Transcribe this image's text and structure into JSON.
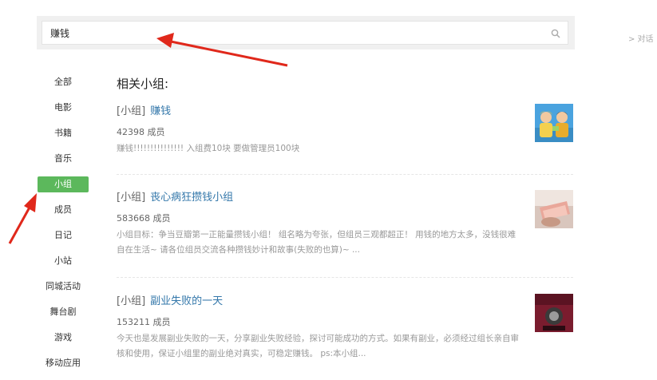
{
  "search": {
    "query": "赚钱"
  },
  "side_link": "> 对话",
  "nav": {
    "items": [
      {
        "label": "全部",
        "active": false
      },
      {
        "label": "电影",
        "active": false
      },
      {
        "label": "书籍",
        "active": false
      },
      {
        "label": "音乐",
        "active": false
      },
      {
        "label": "小组",
        "active": true
      },
      {
        "label": "成员",
        "active": false
      },
      {
        "label": "日记",
        "active": false
      },
      {
        "label": "小站",
        "active": false
      },
      {
        "label": "同城活动",
        "active": false
      },
      {
        "label": "舞台剧",
        "active": false
      },
      {
        "label": "游戏",
        "active": false
      },
      {
        "label": "移动应用",
        "active": false
      }
    ]
  },
  "section_title": "相关小组:",
  "results": [
    {
      "tag": "[小组]",
      "name": "赚钱",
      "members": "42398 成员",
      "description": "赚钱!!!!!!!!!!!!!!! 入组费10块 要做管理员100块"
    },
    {
      "tag": "[小组]",
      "name": "丧心病狂攒钱小组",
      "members": "583668 成员",
      "description": "小组目标：争当豆瓣第一正能量攒钱小组！ 组名略为夸张，但组员三观都超正！ 用钱的地方太多，没钱很难自在生活~ 请各位组员交流各种攒钱妙计和故事(失败的也算)~ ..."
    },
    {
      "tag": "[小组]",
      "name": "副业失败的一天",
      "members": "153211 成员",
      "description": "今天也是发展副业失败的一天，分享副业失败经验，探讨可能成功的方式。如果有副业，必须经过组长亲自审核和使用，保证小组里的副业绝对真实，可稳定赚钱。 ps:本小组..."
    }
  ],
  "colors": {
    "accent": "#5cb85c",
    "link": "#3377aa",
    "arrow": "#e0281b"
  },
  "icons": [
    "search-icon"
  ]
}
